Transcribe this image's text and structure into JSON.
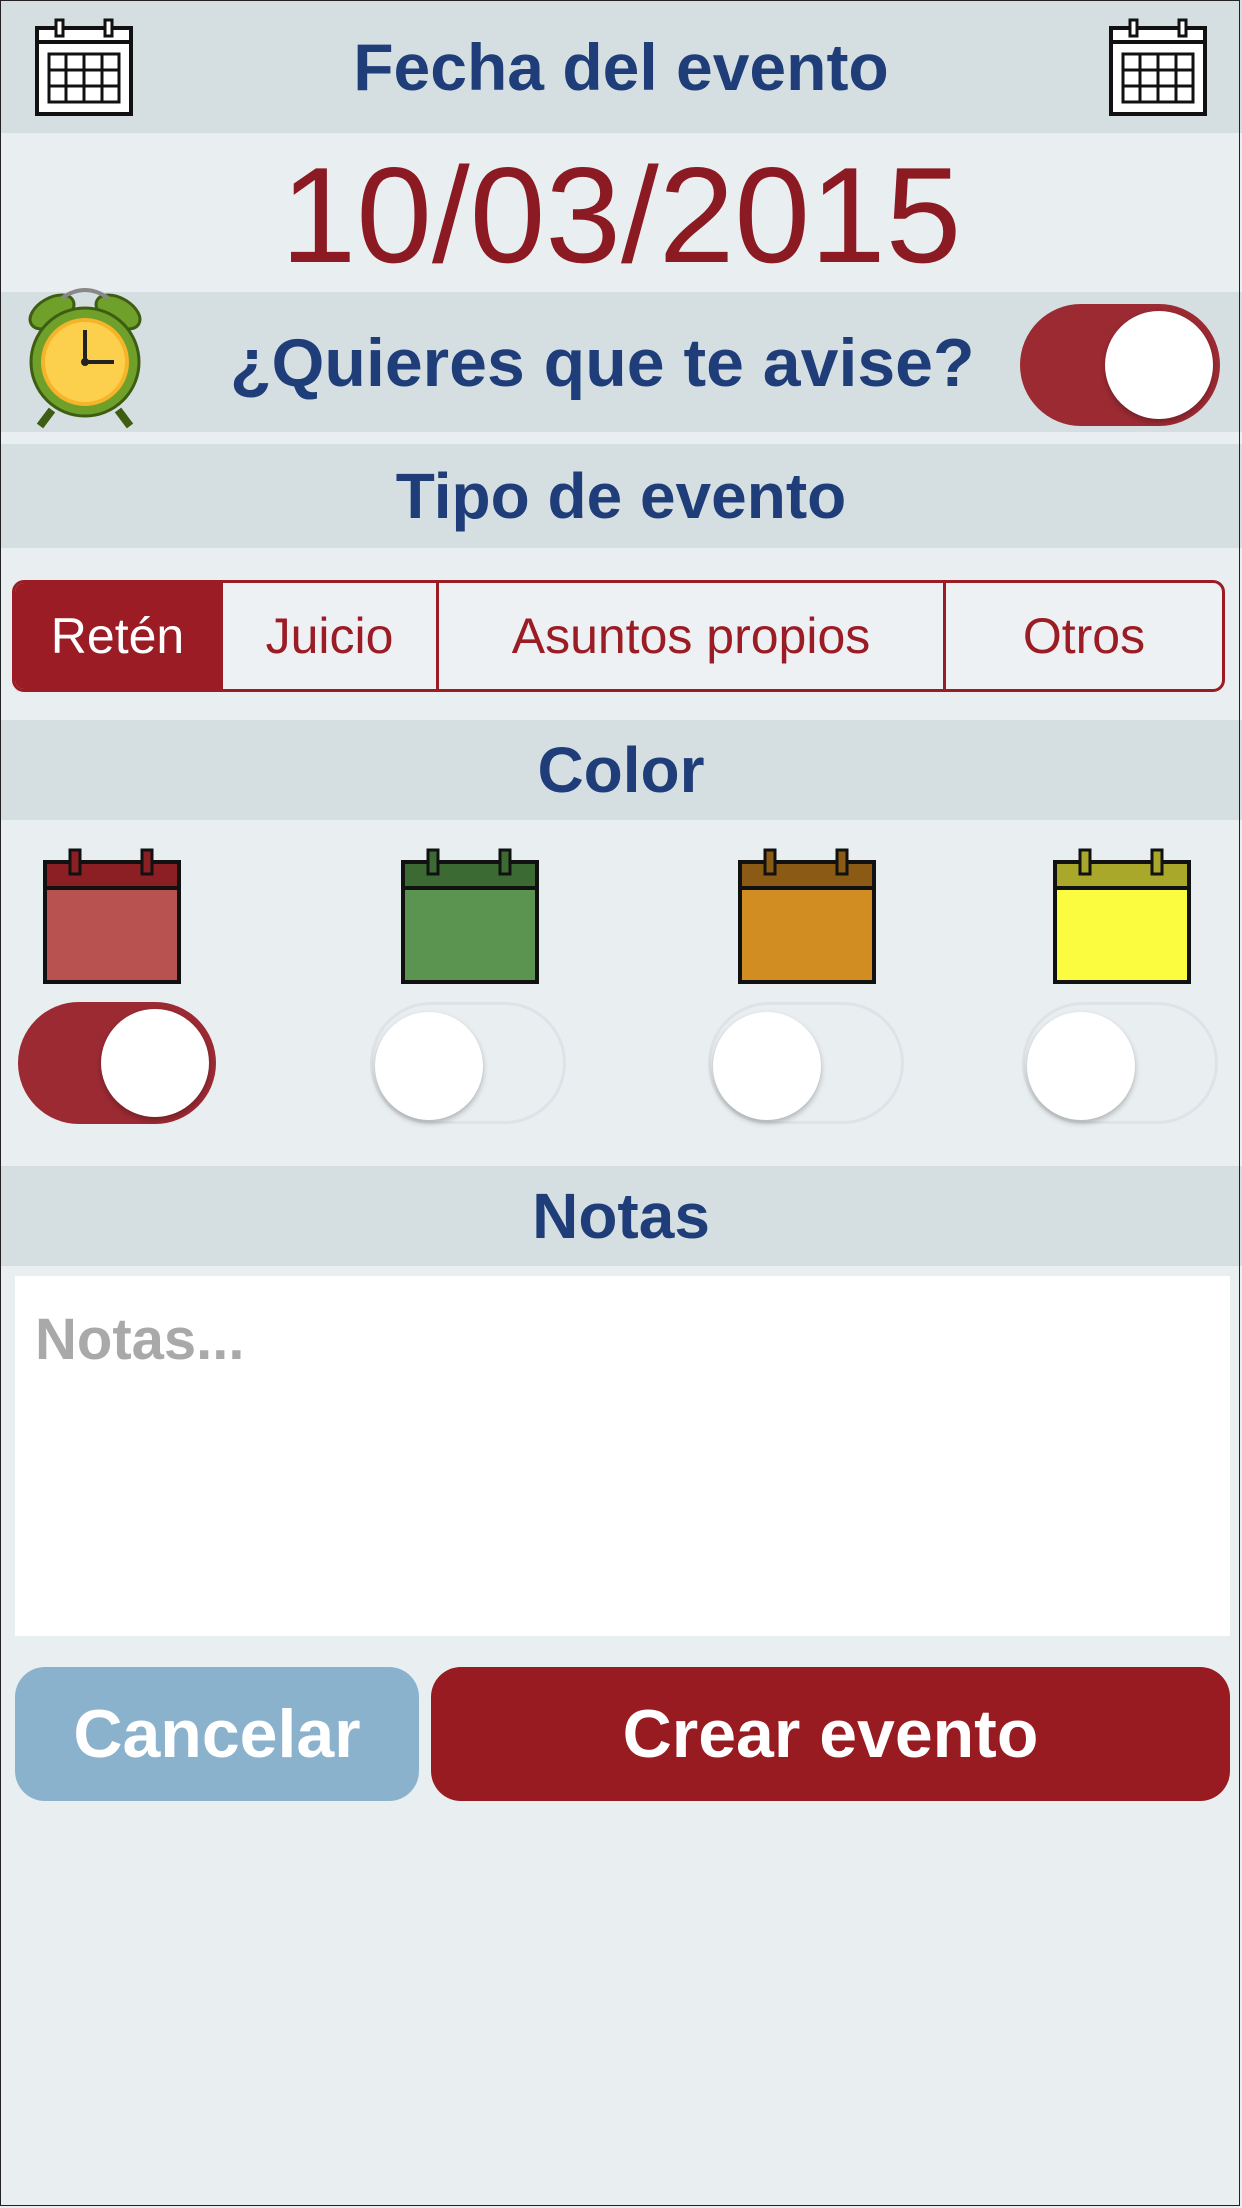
{
  "header": {
    "title": "Fecha del evento"
  },
  "date": {
    "value": "10/03/2015"
  },
  "alarm": {
    "question": "¿Quieres que te avise?",
    "enabled": true
  },
  "event_type": {
    "title": "Tipo de evento",
    "options": [
      "Retén",
      "Juicio",
      "Asuntos propios",
      "Otros"
    ],
    "selected": "Retén"
  },
  "color": {
    "title": "Color",
    "options": [
      {
        "name": "red",
        "header": "#8b1f24",
        "body": "#b85250",
        "selected": true
      },
      {
        "name": "green",
        "header": "#3b6b32",
        "body": "#5b9450",
        "selected": false
      },
      {
        "name": "orange",
        "header": "#8b5a14",
        "body": "#d18c22",
        "selected": false
      },
      {
        "name": "yellow",
        "header": "#a9a82a",
        "body": "#fbfb3f",
        "selected": false
      }
    ]
  },
  "notes": {
    "title": "Notas",
    "placeholder": "Notas...",
    "value": ""
  },
  "actions": {
    "cancel_label": "Cancelar",
    "create_label": "Crear evento"
  },
  "theme": {
    "accent": "#9b1c24",
    "title_color": "#1f3d78",
    "band": "#d5dfe2",
    "background": "#e9eef1",
    "cancel": "#8bb2cd"
  }
}
